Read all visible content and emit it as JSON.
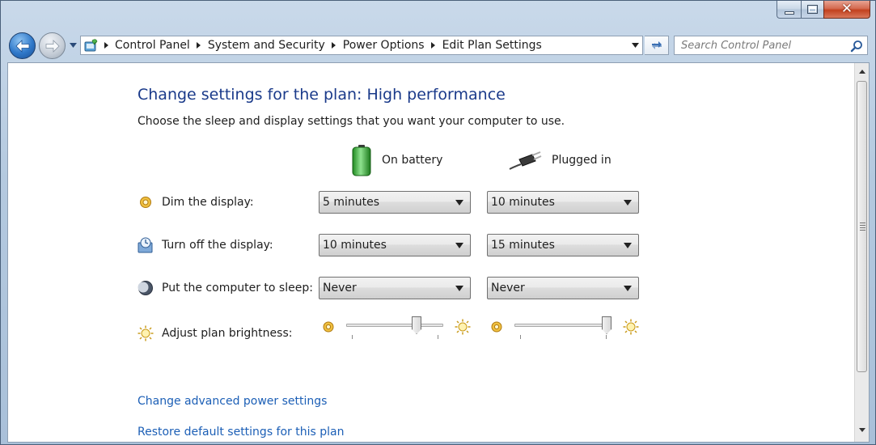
{
  "window": {
    "title": "Edit Plan Settings",
    "caption": {
      "minimize_icon": "minimize-icon",
      "maximize_icon": "maximize-icon",
      "close_glyph": "✕"
    }
  },
  "nav": {
    "breadcrumbs": [
      "Control Panel",
      "System and Security",
      "Power Options",
      "Edit Plan Settings"
    ],
    "search_placeholder": "Search Control Panel"
  },
  "page": {
    "title": "Change settings for the plan: High performance",
    "subtitle": "Choose the sleep and display settings that you want your computer to use.",
    "columns": {
      "battery": "On battery",
      "plugged": "Plugged in"
    }
  },
  "settings": {
    "dim": {
      "label": "Dim the display:",
      "battery": "5 minutes",
      "plugged": "10 minutes"
    },
    "off": {
      "label": "Turn off the display:",
      "battery": "10 minutes",
      "plugged": "15 minutes"
    },
    "sleep": {
      "label": "Put the computer to sleep:",
      "battery": "Never",
      "plugged": "Never"
    },
    "brightness": {
      "label": "Adjust plan brightness:",
      "battery_level": 0.75,
      "plugged_level": 1.0
    }
  },
  "links": {
    "advanced": "Change advanced power settings",
    "restore": "Restore default settings for this plan"
  },
  "colors": {
    "title": "#1a3a8a",
    "link": "#1c5fb6",
    "window_frame": "#b4c9df"
  }
}
